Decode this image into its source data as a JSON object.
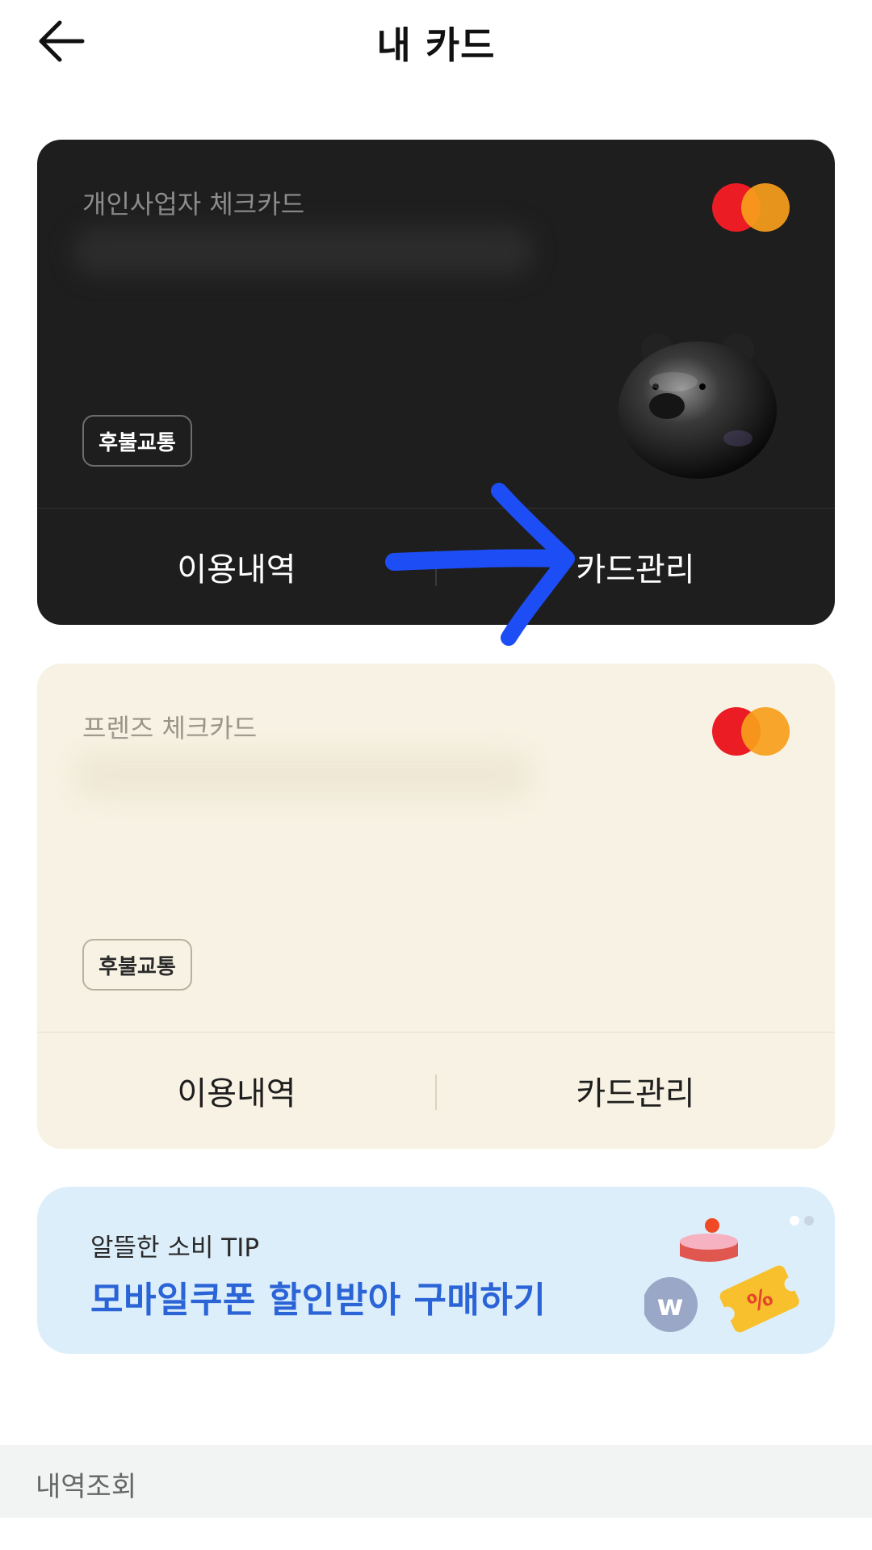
{
  "header": {
    "title": "내 카드",
    "back_icon": "arrow-left-icon"
  },
  "cards": [
    {
      "name": "개인사업자 체크카드",
      "badge": "후불교통",
      "brand_icon": "mastercard-logo",
      "actions": {
        "history": "이용내역",
        "manage": "카드관리"
      },
      "colors": {
        "background": "#1e1e1e",
        "text": "#ffffff"
      }
    },
    {
      "name": "프렌즈 체크카드",
      "badge": "후불교통",
      "brand_icon": "mastercard-logo",
      "actions": {
        "history": "이용내역",
        "manage": "카드관리"
      },
      "colors": {
        "background": "#f8f2e4",
        "text": "#1e1e1e"
      }
    }
  ],
  "tip_banner": {
    "small_text": "알뜰한 소비 TIP",
    "headline": "모바일쿠폰 할인받아 구매하기",
    "colors": {
      "background": "#ddeefb",
      "headline": "#2a64d6"
    }
  },
  "section": {
    "title": "내역조회"
  }
}
